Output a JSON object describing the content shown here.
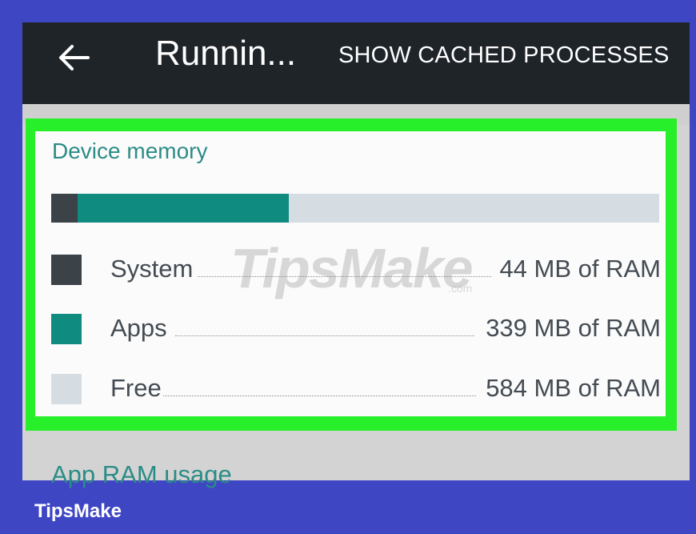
{
  "app_bar": {
    "title": "Runnin...",
    "action_label": "SHOW CACHED PROCESSES",
    "back_icon": "back-arrow-icon"
  },
  "device_memory": {
    "title": "Device memory",
    "usage_fractions": {
      "system": 0.044,
      "apps": 0.347,
      "free": 0.609
    },
    "rows": [
      {
        "name": "System",
        "value": "44 MB of RAM",
        "color": "#3b4248"
      },
      {
        "name": "Apps",
        "value": "339 MB of RAM",
        "color": "#0f8b80"
      },
      {
        "name": "Free",
        "value": "584 MB of RAM",
        "color": "#d5dde3"
      }
    ]
  },
  "next_section": {
    "title": "App RAM usage"
  },
  "watermark": {
    "brand": "TipsMake",
    "suffix": ".com"
  },
  "footer": {
    "brand": "TipsMake"
  },
  "colors": {
    "frame_border": "#3f46c4",
    "highlight": "#27ef2a",
    "accent": "#2b8c86"
  }
}
